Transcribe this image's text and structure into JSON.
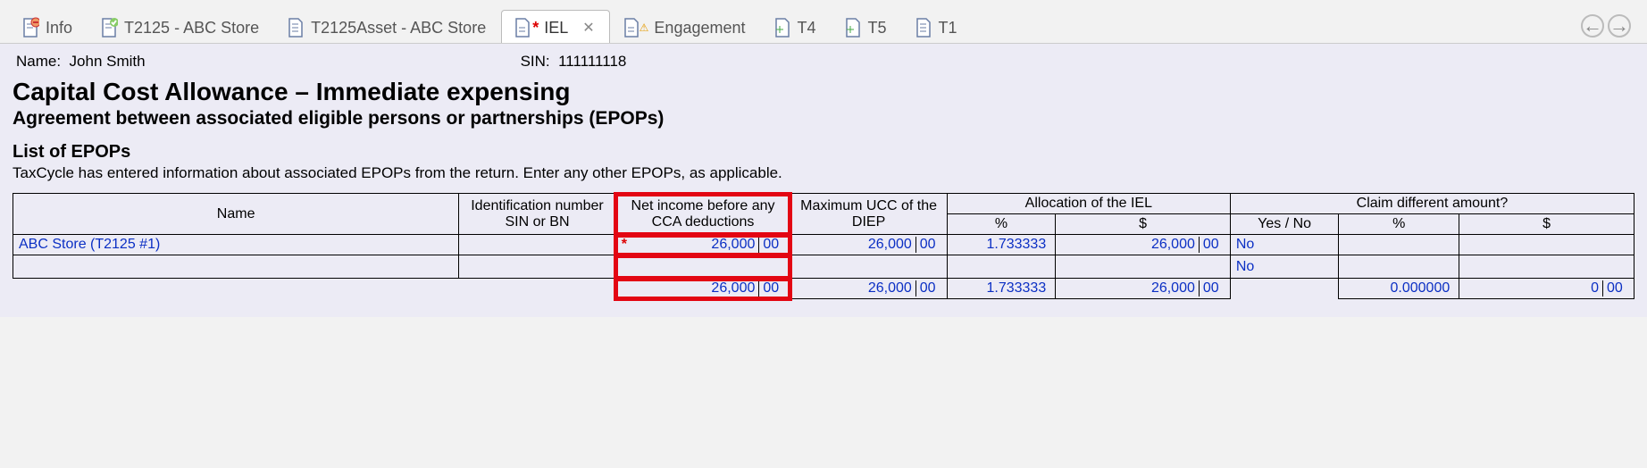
{
  "tabs": [
    {
      "label": "Info",
      "icon": "doc-minus"
    },
    {
      "label": "T2125 - ABC Store",
      "icon": "doc-check"
    },
    {
      "label": "T2125Asset - ABC Store",
      "icon": "doc"
    },
    {
      "label": "IEL",
      "icon": "doc-star",
      "active": true,
      "closeable": true
    },
    {
      "label": "Engagement",
      "icon": "doc-warn"
    },
    {
      "label": "T4",
      "icon": "doc-plus"
    },
    {
      "label": "T5",
      "icon": "doc-plus"
    },
    {
      "label": "T1",
      "icon": "doc"
    }
  ],
  "nameLabel": "Name:",
  "nameValue": "John Smith",
  "sinLabel": "SIN:",
  "sinValue": "111111118",
  "h1": "Capital Cost Allowance – Immediate expensing",
  "h2": "Agreement between associated eligible persons or partnerships (EPOPs)",
  "h3": "List of EPOPs",
  "instr": "TaxCycle has entered information about associated EPOPs from the return. Enter any other EPOPs, as applicable.",
  "headers": {
    "name": "Name",
    "id": "Identification number SIN or BN",
    "netinc": "Net income before any CCA deductions",
    "maxucc": "Maximum UCC of the DIEP",
    "alloc": "Allocation of the IEL",
    "pct": "%",
    "dol": "$",
    "claimdiff": "Claim different amount?",
    "yesno": "Yes / No"
  },
  "rows": [
    {
      "name": "ABC Store (T2125 #1)",
      "id": "",
      "net_dol": "26,000",
      "net_cent": "00",
      "net_star": true,
      "ucc_dol": "26,000",
      "ucc_cent": "00",
      "pct": "1.733333",
      "alloc_dol": "26,000",
      "alloc_cent": "00",
      "yesno": "No",
      "cd_pct": "",
      "cd_dol": "",
      "cd_cent": ""
    },
    {
      "name": "",
      "id": "",
      "net_dol": "",
      "net_cent": "",
      "net_star": false,
      "ucc_dol": "",
      "ucc_cent": "",
      "pct": "",
      "alloc_dol": "",
      "alloc_cent": "",
      "yesno": "No",
      "cd_pct": "",
      "cd_dol": "",
      "cd_cent": ""
    }
  ],
  "totals": {
    "net_dol": "26,000",
    "net_cent": "00",
    "ucc_dol": "26,000",
    "ucc_cent": "00",
    "pct": "1.733333",
    "alloc_dol": "26,000",
    "alloc_cent": "00",
    "cd_pct": "0.000000",
    "cd_dol": "0",
    "cd_cent": "00"
  }
}
